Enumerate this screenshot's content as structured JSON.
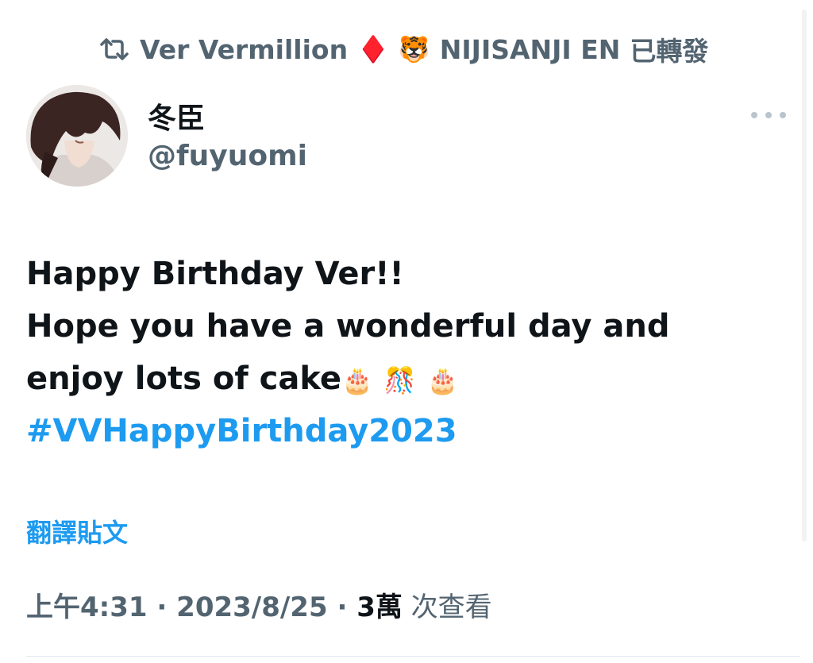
{
  "retweet_banner": {
    "retweeter": "Ver Vermillion",
    "diamond_emoji": "♦️",
    "tiger_emoji": "🐯",
    "account": "NIJISANJI EN",
    "action": "已轉發"
  },
  "author": {
    "display_name": "冬臣",
    "handle": "@fuyuomi"
  },
  "tweet": {
    "line1": "Happy Birthday Ver!!",
    "line2": "Hope you have a wonderful day and",
    "line3": "enjoy lots of cake",
    "emoji1": "🎂",
    "emoji2": "🎊",
    "emoji3": "🎂",
    "hashtag": "#VVHappyBirthday2023"
  },
  "translate_label": "翻譯貼文",
  "meta": {
    "time": "上午4:31",
    "sep1": " · ",
    "date": "2023/8/25",
    "sep2": " · ",
    "views_count": "3萬",
    "views_label": " 次查看"
  },
  "colors": {
    "link": "#1d9bf0",
    "secondary_text": "#536471",
    "primary_text": "#0f1419"
  },
  "icons": {
    "retweet": "retweet-icon",
    "more": "more-icon"
  }
}
